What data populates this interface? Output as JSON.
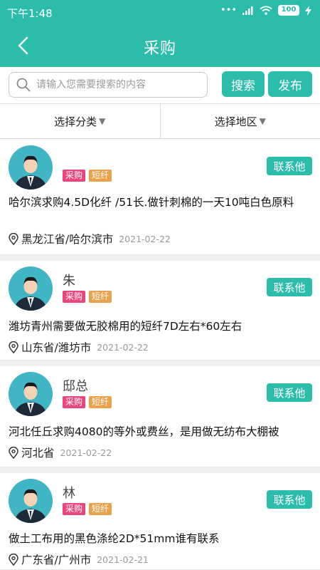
{
  "status_bar": {
    "time": "下午1:48",
    "battery": "100"
  },
  "nav": {
    "title": "采购"
  },
  "search": {
    "placeholder": "请输入您需要搜索的内容",
    "search_label": "搜索",
    "publish_label": "发布"
  },
  "filters": {
    "category": "选择分类",
    "region": "选择地区"
  },
  "posts": [
    {
      "name": "",
      "tags": [
        "采购",
        "短纤"
      ],
      "contact_label": "联系他",
      "content": "哈尔滨求购4.5D化纤 /51长.做针刺棉的一天10吨白色原料",
      "location": "黑龙江省/哈尔滨市",
      "date": "2021-02-22"
    },
    {
      "name": "朱",
      "tags": [
        "采购",
        "短纤"
      ],
      "contact_label": "联系他",
      "content": "潍坊青州需要做无胶棉用的短纤7D左右*60左右",
      "location": "山东省/潍坊市",
      "date": "2021-02-22"
    },
    {
      "name": "邸总",
      "tags": [
        "采购",
        "短纤"
      ],
      "contact_label": "联系他",
      "content": "河北任丘求购4080的等外或费丝，是用做无纺布大棚被",
      "location": "河北省",
      "date": "2021-02-22"
    },
    {
      "name": "林",
      "tags": [
        "采购",
        "短纤"
      ],
      "contact_label": "联系他",
      "content": "做土工布用的黑色涤纶2D*51mm谁有联系",
      "location": "广东省/广州市",
      "date": "2021-02-21"
    }
  ],
  "colors": {
    "accent": "#2bbcaa",
    "tag_buy": "#e8467c",
    "tag_fiber": "#eaa14a"
  }
}
